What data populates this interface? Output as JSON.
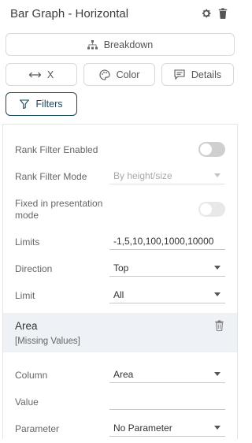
{
  "header": {
    "title": "Bar Graph - Horizontal"
  },
  "buttons": {
    "breakdown": "Breakdown",
    "x": "X",
    "color": "Color",
    "details": "Details",
    "filters": "Filters"
  },
  "filters": {
    "rank_filter_enabled": {
      "label": "Rank Filter Enabled",
      "on": false
    },
    "rank_filter_mode": {
      "label": "Rank Filter Mode",
      "value": "By height/size"
    },
    "fixed_presentation": {
      "label_line1": "Fixed in presentation",
      "label_line2": "mode",
      "on": false
    },
    "limits": {
      "label": "Limits",
      "value": "-1,5,10,100,1000,10000"
    },
    "direction": {
      "label": "Direction",
      "value": "Top"
    },
    "limit": {
      "label": "Limit",
      "value": "All"
    }
  },
  "area": {
    "title": "Area",
    "subtitle": "[Missing Values]",
    "column": {
      "label": "Column",
      "value": "Area"
    },
    "value": {
      "label": "Value",
      "value": ""
    },
    "parameter": {
      "label": "Parameter",
      "value": "No Parameter"
    }
  },
  "colors": {
    "accent": "#1b4a5f",
    "band": "#eef1f5",
    "toggle_off": "#cfcfcf"
  },
  "icons": {
    "gear": "gear-icon",
    "trash": "trash-icon",
    "breakdown": "hierarchy-icon",
    "x": "horizontal-arrows-icon",
    "color": "palette-icon",
    "details": "comment-icon",
    "filters": "funnel-icon"
  }
}
